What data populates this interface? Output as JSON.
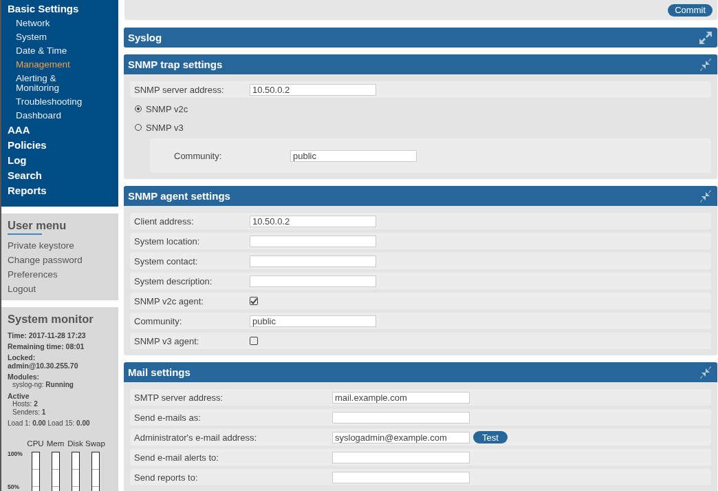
{
  "sidebar": {
    "nav": [
      {
        "label": "Basic Settings",
        "selected": false,
        "children": [
          {
            "label": "Network",
            "selected": false
          },
          {
            "label": "System",
            "selected": false
          },
          {
            "label": "Date & Time",
            "selected": false
          },
          {
            "label": "Management",
            "selected": true
          },
          {
            "label": "Alerting & Monitoring",
            "selected": false
          },
          {
            "label": "Troubleshooting",
            "selected": false
          },
          {
            "label": "Dashboard",
            "selected": false
          }
        ]
      },
      {
        "label": "AAA",
        "selected": false
      },
      {
        "label": "Policies",
        "selected": false
      },
      {
        "label": "Log",
        "selected": false
      },
      {
        "label": "Search",
        "selected": false
      },
      {
        "label": "Reports",
        "selected": false
      }
    ],
    "user_menu": {
      "title": "User menu",
      "items": [
        "Private keystore",
        "Change password",
        "Preferences",
        "Logout"
      ]
    },
    "system_monitor": {
      "title": "System monitor",
      "lines": [
        {
          "kind": "heading",
          "text": "Time: 2017-11-28 17:23"
        },
        {
          "kind": "heading",
          "text": "Remaining time: 08:01"
        },
        {
          "kind": "heading",
          "text": "Locked:"
        },
        {
          "kind": "value",
          "text": "admin@10.30.255.70"
        },
        {
          "kind": "heading",
          "text": "Modules:"
        },
        {
          "kind": "item",
          "text": "syslog-ng: **Running**"
        },
        {
          "kind": "heading",
          "text": "Active"
        },
        {
          "kind": "subitem",
          "text": "Hosts: **2**"
        },
        {
          "kind": "subitem",
          "text": "Senders: **1**"
        },
        {
          "kind": "plain",
          "text": "Load 1: **0.00** Load 15: **0.00**"
        }
      ],
      "graph": {
        "columns": [
          "CPU",
          "Mem",
          "Disk",
          "Swap"
        ],
        "ticks": [
          "100%",
          "50%"
        ]
      }
    }
  },
  "commit_button": "Commit",
  "panels": [
    {
      "title": "Syslog",
      "expanded": false
    },
    {
      "title": "SNMP trap settings",
      "expanded": true,
      "rows": [
        {
          "kind": "field",
          "label": "SNMP server address:",
          "value": "10.50.0.2"
        },
        {
          "kind": "radio",
          "label": "SNMP v2c",
          "selected": true
        },
        {
          "kind": "radio",
          "label": "SNMP v3",
          "selected": false
        },
        {
          "kind": "subpanel",
          "label": "Community:",
          "value": "public"
        }
      ]
    },
    {
      "title": "SNMP agent settings",
      "expanded": true,
      "rows": [
        {
          "kind": "field",
          "label": "Client address:",
          "value": "10.50.0.2"
        },
        {
          "kind": "field",
          "label": "System location:"
        },
        {
          "kind": "field",
          "label": "System contact:"
        },
        {
          "kind": "field",
          "label": "System description:"
        },
        {
          "kind": "checkbox",
          "label": "SNMP v2c agent:",
          "checked": true
        },
        {
          "kind": "field",
          "label": "Community:",
          "value": "public"
        },
        {
          "kind": "checkbox",
          "label": "SNMP v3 agent:",
          "checked": false
        }
      ]
    },
    {
      "title": "Mail settings",
      "expanded": true,
      "rows": [
        {
          "kind": "field",
          "label": "SMTP server address:",
          "value": "mail.example.com"
        },
        {
          "kind": "field",
          "label": "Send e-mails as:"
        },
        {
          "kind": "field",
          "label": "Administrator's e-mail address:",
          "value": "syslogadmin@example.com",
          "button": "Test"
        },
        {
          "kind": "field",
          "label": "Send e-mail alerts to:"
        },
        {
          "kind": "field",
          "label": "Send reports to:"
        }
      ]
    }
  ]
}
